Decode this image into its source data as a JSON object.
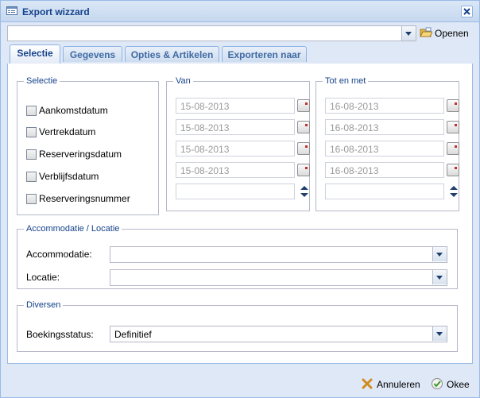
{
  "window": {
    "title": "Export wizzard"
  },
  "toolbar": {
    "select_value": "",
    "open_label": "Openen"
  },
  "tabs": [
    {
      "label": "Selectie"
    },
    {
      "label": "Gegevens"
    },
    {
      "label": "Opties & Artikelen"
    },
    {
      "label": "Exporteren naar"
    }
  ],
  "selectie": {
    "legend": "Selectie",
    "items": [
      {
        "label": "Aankomstdatum"
      },
      {
        "label": "Vertrekdatum"
      },
      {
        "label": "Reserveringsdatum"
      },
      {
        "label": "Verblijfsdatum"
      },
      {
        "label": "Reserveringsnummer"
      }
    ]
  },
  "van": {
    "legend": "Van",
    "dates": [
      "15-08-2013",
      "15-08-2013",
      "15-08-2013",
      "15-08-2013"
    ],
    "number": ""
  },
  "totenmet": {
    "legend": "Tot en met",
    "dates": [
      "16-08-2013",
      "16-08-2013",
      "16-08-2013",
      "16-08-2013"
    ],
    "number": ""
  },
  "accommodatie": {
    "legend": "Accommodatie / Locatie",
    "accommodatie_label": "Accommodatie:",
    "accommodatie_value": "",
    "locatie_label": "Locatie:",
    "locatie_value": ""
  },
  "diversen": {
    "legend": "Diversen",
    "status_label": "Boekingsstatus:",
    "status_value": "Definitief"
  },
  "footer": {
    "cancel_label": "Annuleren",
    "ok_label": "Okee"
  }
}
